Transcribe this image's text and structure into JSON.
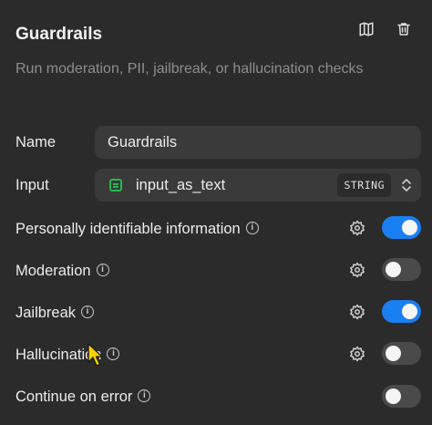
{
  "panel": {
    "title": "Guardrails",
    "description": "Run moderation, PII, jailbreak, or hallucination checks"
  },
  "header_icons": {
    "docs": "book-open-icon",
    "delete": "trash-icon"
  },
  "fields": {
    "name_label": "Name",
    "name_value": "Guardrails",
    "input_label": "Input",
    "input_value": "input_as_text",
    "input_type": "STRING"
  },
  "checks": [
    {
      "label": "Personally identifiable information",
      "enabled": true,
      "has_settings": true
    },
    {
      "label": "Moderation",
      "enabled": false,
      "has_settings": true
    },
    {
      "label": "Jailbreak",
      "enabled": true,
      "has_settings": true
    },
    {
      "label": "Hallucination",
      "enabled": false,
      "has_settings": true
    },
    {
      "label": "Continue on error",
      "enabled": false,
      "has_settings": false
    }
  ],
  "colors": {
    "toggle_on": "#1a7ff0",
    "toggle_off": "#4a4a4a",
    "variable_icon": "#25b84f",
    "cursor": "#f5d000"
  }
}
